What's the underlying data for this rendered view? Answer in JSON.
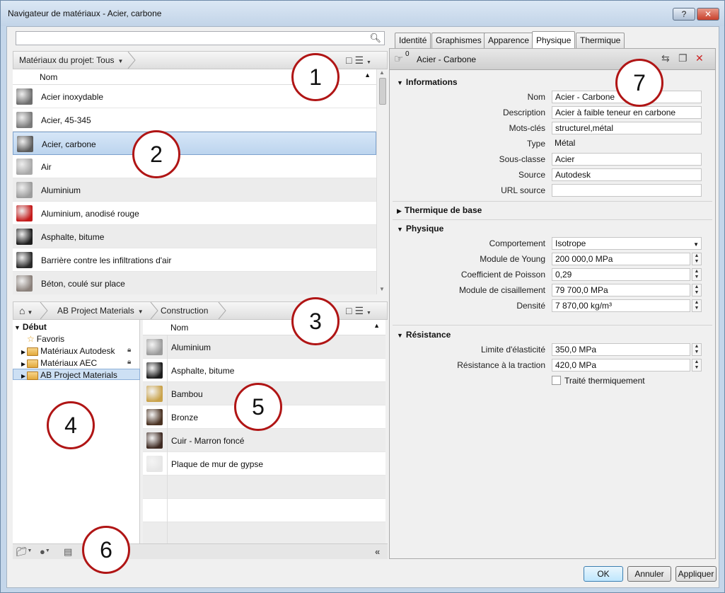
{
  "window": {
    "title": "Navigateur de matériaux - Acier, carbone",
    "help_label": "?",
    "close_label": "✕"
  },
  "search": {
    "placeholder": "",
    "icon": "search-icon"
  },
  "project": {
    "crumb": "Matériaux du projet: Tous",
    "header_name": "Nom",
    "materials": [
      {
        "name": "Acier inoxydable",
        "color": "#6e6e6e"
      },
      {
        "name": "Acier, 45-345",
        "color": "#7a7a7a"
      },
      {
        "name": "Acier, carbone",
        "color": "#5c5c5c"
      },
      {
        "name": "Air",
        "color": "#a9a9a9"
      },
      {
        "name": "Aluminium",
        "color": "#9c9c9c"
      },
      {
        "name": "Aluminium, anodisé rouge",
        "color": "#c41a1a"
      },
      {
        "name": "Asphalte, bitume",
        "color": "#1e1e1e"
      },
      {
        "name": "Barrière contre les infiltrations d'air",
        "color": "#2a2a2a"
      },
      {
        "name": "Béton, coulé sur place",
        "color": "#8a807a"
      }
    ]
  },
  "library": {
    "crumbs": [
      "AB Project Materials",
      "Construction"
    ],
    "header_name": "Nom",
    "tree": [
      {
        "label": "Début"
      },
      {
        "label": "Favoris"
      },
      {
        "label": "Matériaux Autodesk"
      },
      {
        "label": "Matériaux AEC"
      },
      {
        "label": "AB Project Materials"
      }
    ],
    "materials": [
      {
        "name": "Aluminium",
        "color": "#9a9a9a"
      },
      {
        "name": "Asphalte, bitume",
        "color": "#1c1c1c"
      },
      {
        "name": "Bambou",
        "color": "#c9a24a"
      },
      {
        "name": "Bronze",
        "color": "#4a3222"
      },
      {
        "name": "Cuir - Marron foncé",
        "color": "#3e2a22"
      },
      {
        "name": "Plaque de mur de gypse",
        "color": "#e6e6e6"
      }
    ]
  },
  "tabs": [
    "Identité",
    "Graphismes",
    "Apparence",
    "Physique",
    "Thermique"
  ],
  "props": {
    "header": "Acier - Carbone",
    "header_count": "0",
    "sections": {
      "info": "Informations",
      "thermal": "Thermique de base",
      "physical": "Physique",
      "resistance": "Résistance"
    },
    "info": [
      {
        "label": "Nom",
        "value": "Acier - Carbone"
      },
      {
        "label": "Description",
        "value": "Acier à faible teneur en carbone"
      },
      {
        "label": "Mots-clés",
        "value": "structurel,métal"
      },
      {
        "label": "Type",
        "value": "Métal"
      },
      {
        "label": "Sous-classe",
        "value": "Acier"
      },
      {
        "label": "Source",
        "value": "Autodesk"
      },
      {
        "label": "URL source",
        "value": ""
      }
    ],
    "physical": [
      {
        "label": "Comportement",
        "value": "Isotrope"
      },
      {
        "label": "Module de Young",
        "value": "200 000,0 MPa"
      },
      {
        "label": "Coefficient de Poisson",
        "value": "0,29"
      },
      {
        "label": "Module de cisaillement",
        "value": "79 700,0 MPa"
      },
      {
        "label": "Densité",
        "value": "7 870,00 kg/m³"
      }
    ],
    "resistance": [
      {
        "label": "Limite d'élasticité",
        "value": "350,0 MPa"
      },
      {
        "label": "Résistance à la traction",
        "value": "420,0 MPa"
      }
    ],
    "heat_treated": "Traité thermiquement"
  },
  "buttons": {
    "ok": "OK",
    "cancel": "Annuler",
    "apply": "Appliquer"
  },
  "callouts": [
    "1",
    "2",
    "3",
    "4",
    "5",
    "6",
    "7"
  ],
  "colors": {
    "selection": "#bcd4ee",
    "callout_ring": "#b01515",
    "delete": "#cc2222"
  }
}
